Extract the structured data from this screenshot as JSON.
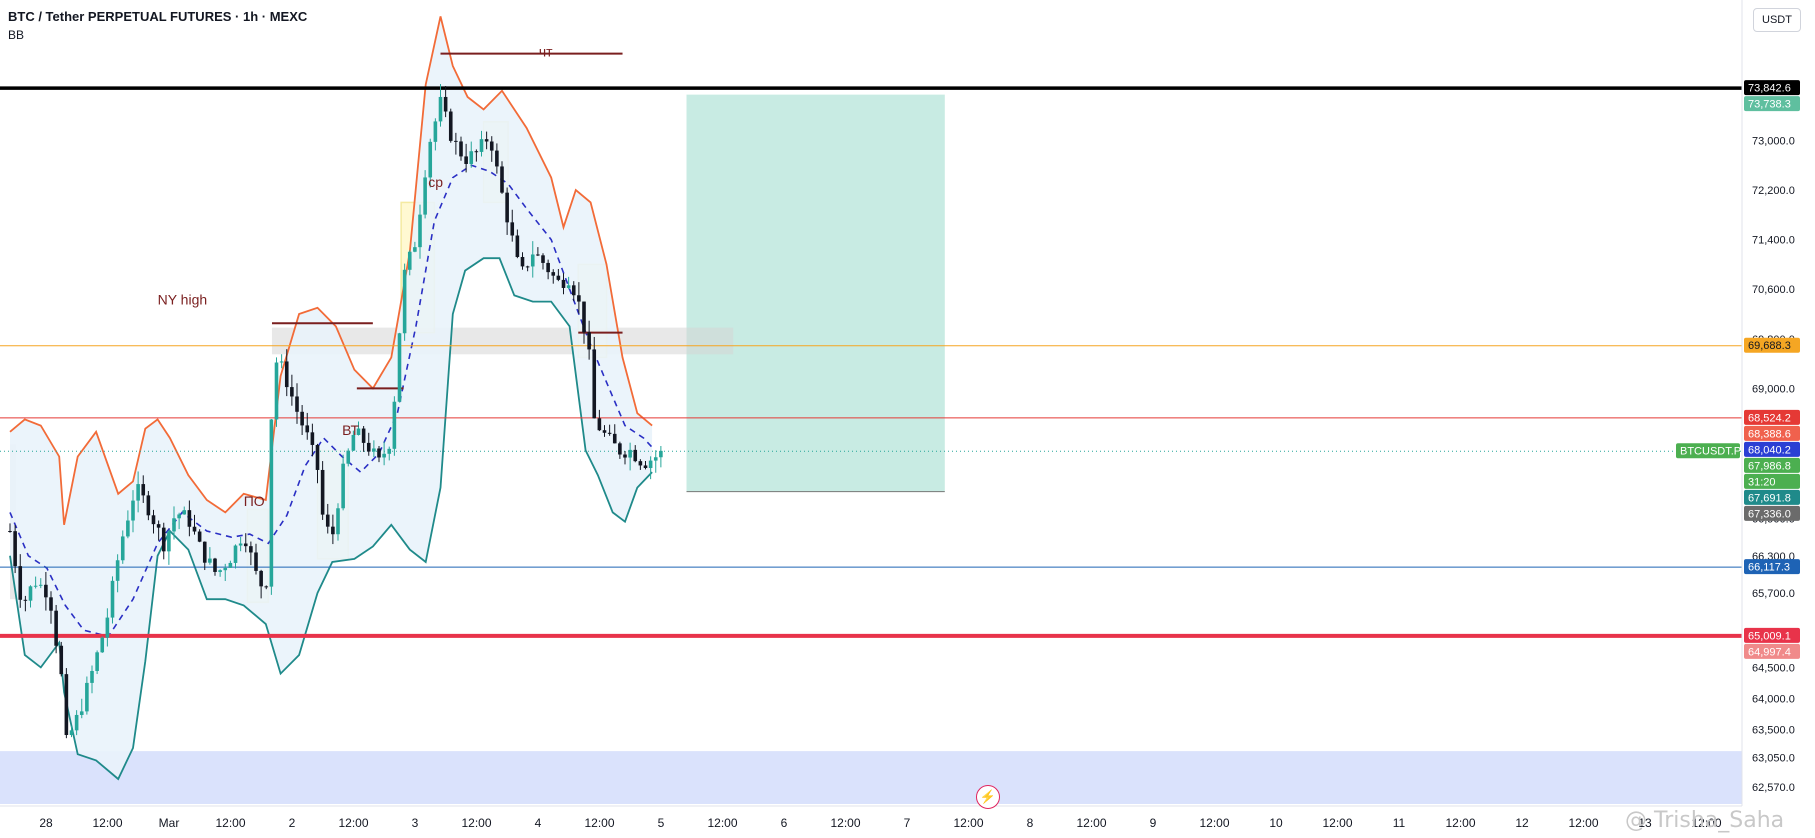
{
  "header": {
    "title": "BTC / Tether PERPETUAL FUTURES · 1h · MEXC",
    "indicator": "BB"
  },
  "currency_button": "USDT",
  "watermark": "@ Trisha_Saha",
  "icons": {
    "bolt": "lightning-bolt-icon"
  },
  "colors": {
    "up": "#26a69a",
    "down": "#131722",
    "bb_upper": "#f26b38",
    "bb_lower": "#1f8a8a",
    "bb_basis": "#2a2fc4",
    "bb_fill": "#e9f3fb",
    "line_black": "#000000",
    "line_orange": "#f5a623",
    "line_red_thin": "#e53935",
    "line_blue": "#1e63b5",
    "line_red_thick": "#e8334a",
    "target_zone": "#c8ebe3",
    "stop_zone": "#fde6e6",
    "demand_zone": "#d3ddfb",
    "supply_box": "#d6d6d6",
    "annotation": "#7a1f1f"
  },
  "chart_data": {
    "type": "candlestick",
    "symbol_label": "BTCUSDT.P",
    "ylim": [
      62200,
      75200
    ],
    "y_ticks": [
      62570,
      63050,
      63500,
      64000,
      64500,
      65000,
      65700,
      66300,
      66900,
      67300,
      69000,
      69800,
      70600,
      71400,
      72200,
      73000
    ],
    "y_tick_labels": [
      "62,570.0",
      "63,050.0",
      "63,500.0",
      "64,000.0",
      "64,500.0",
      "65,100.0",
      "65,700.0",
      "66,300.0",
      "66,900.0",
      "67,300.0",
      "69,000.0",
      "69,800.0",
      "70,600.0",
      "71,400.0",
      "72,200.0",
      "73,000.0"
    ],
    "x_labels": [
      "28",
      "12:00",
      "Mar",
      "12:00",
      "2",
      "12:00",
      "3",
      "12:00",
      "4",
      "12:00",
      "5",
      "12:00",
      "6",
      "12:00",
      "7",
      "12:00",
      "8",
      "12:00",
      "9",
      "12:00",
      "10",
      "12:00",
      "11",
      "12:00",
      "12",
      "12:00",
      "13",
      "12:00"
    ],
    "price_labels": [
      {
        "text": "73,842.6",
        "value": 73842.6,
        "bg": "#000000",
        "color": "#ffffff"
      },
      {
        "text": "73,738.3",
        "value": 73738.3,
        "bg": "#5fbf9f",
        "color": "#ffffff"
      },
      {
        "text": "69,688.3",
        "value": 69688.3,
        "bg": "#f5a623",
        "color": "#131722"
      },
      {
        "text": "68,524.2",
        "value": 68524.2,
        "bg": "#e53935",
        "color": "#ffffff"
      },
      {
        "text": "68,388.6",
        "value": 68388.6,
        "bg": "#f0614d",
        "color": "#ffffff"
      },
      {
        "text": "68,040.2",
        "value": 68040.2,
        "bg": "#2a3fd4",
        "color": "#ffffff"
      },
      {
        "text": "67,986.8",
        "value": 67986.8,
        "bg": "#4caf50",
        "color": "#ffffff"
      },
      {
        "text": "31:20",
        "value": 67820,
        "bg": "#4caf50",
        "color": "#ffffff"
      },
      {
        "text": "67,691.8",
        "value": 67691.8,
        "bg": "#1f8a8a",
        "color": "#ffffff"
      },
      {
        "text": "67,336.0",
        "value": 67336.0,
        "bg": "#6b6b6b",
        "color": "#ffffff"
      },
      {
        "text": "66,117.3",
        "value": 66117.3,
        "bg": "#1e63b5",
        "color": "#ffffff"
      },
      {
        "text": "65,009.1",
        "value": 65009.1,
        "bg": "#e8334a",
        "color": "#ffffff"
      },
      {
        "text": "64,997.4",
        "value": 64997.4,
        "bg": "#f08a8a",
        "color": "#ffffff"
      }
    ],
    "horizontal_lines": [
      {
        "value": 73842.6,
        "color": "#000000",
        "width": 3.5
      },
      {
        "value": 69688.3,
        "color": "#f5a623",
        "width": 1
      },
      {
        "value": 68524.2,
        "color": "#e53935",
        "width": 1
      },
      {
        "value": 66117.3,
        "color": "#1e63b5",
        "width": 1
      },
      {
        "value": 65009.1,
        "color": "#e8334a",
        "width": 4
      }
    ],
    "current_price": 67986.8,
    "annotations": [
      {
        "text": "NY high",
        "x": 1.2,
        "y": 70350
      },
      {
        "text": "ВТ",
        "x": 2.7,
        "y": 68250
      },
      {
        "text": "ПО",
        "x": 1.9,
        "y": 67100
      },
      {
        "text": "ср",
        "x": 3.4,
        "y": 72250
      },
      {
        "text": "чт",
        "x": 4.3,
        "y": 74350
      }
    ],
    "position": {
      "entry": 67336.0,
      "target": 73738.3,
      "stop": 65009.1
    },
    "candle_path": [
      [
        0.0,
        66700
      ],
      [
        0.1,
        65500
      ],
      [
        0.2,
        65900
      ],
      [
        0.32,
        65700
      ],
      [
        0.42,
        64300
      ],
      [
        0.44,
        63200
      ],
      [
        0.55,
        63700
      ],
      [
        0.65,
        64300
      ],
      [
        0.78,
        65200
      ],
      [
        0.9,
        66500
      ],
      [
        1.02,
        67400
      ],
      [
        1.12,
        67100
      ],
      [
        1.25,
        66500
      ],
      [
        1.35,
        67000
      ],
      [
        1.45,
        66900
      ],
      [
        1.55,
        66400
      ],
      [
        1.68,
        66000
      ],
      [
        1.8,
        66300
      ],
      [
        1.9,
        66700
      ],
      [
        2.0,
        66000
      ],
      [
        2.08,
        65700
      ],
      [
        2.14,
        69500
      ],
      [
        2.22,
        69300
      ],
      [
        2.32,
        68700
      ],
      [
        2.42,
        68200
      ],
      [
        2.5,
        67700
      ],
      [
        2.55,
        66800
      ],
      [
        2.62,
        66600
      ],
      [
        2.7,
        67600
      ],
      [
        2.8,
        68300
      ],
      [
        2.9,
        68100
      ],
      [
        3.0,
        67800
      ],
      [
        3.1,
        68200
      ],
      [
        3.2,
        70800
      ],
      [
        3.3,
        71400
      ],
      [
        3.4,
        72900
      ],
      [
        3.5,
        73600
      ],
      [
        3.6,
        73000
      ],
      [
        3.7,
        72700
      ],
      [
        3.8,
        72800
      ],
      [
        3.9,
        73100
      ],
      [
        3.98,
        72300
      ],
      [
        4.05,
        71700
      ],
      [
        4.15,
        70800
      ],
      [
        4.25,
        71200
      ],
      [
        4.35,
        71000
      ],
      [
        4.45,
        70700
      ],
      [
        4.55,
        70800
      ],
      [
        4.62,
        70400
      ],
      [
        4.7,
        69700
      ],
      [
        4.75,
        68500
      ],
      [
        4.85,
        68200
      ],
      [
        4.95,
        68000
      ],
      [
        5.05,
        68000
      ],
      [
        5.15,
        67800
      ],
      [
        5.25,
        67900
      ],
      [
        5.32,
        67980
      ]
    ],
    "bb_upper": [
      [
        0.0,
        68300
      ],
      [
        0.12,
        68500
      ],
      [
        0.25,
        68400
      ],
      [
        0.4,
        67900
      ],
      [
        0.44,
        66800
      ],
      [
        0.55,
        67900
      ],
      [
        0.7,
        68300
      ],
      [
        0.88,
        67300
      ],
      [
        1.0,
        67500
      ],
      [
        1.1,
        68350
      ],
      [
        1.2,
        68500
      ],
      [
        1.3,
        68200
      ],
      [
        1.45,
        67600
      ],
      [
        1.6,
        67200
      ],
      [
        1.75,
        67000
      ],
      [
        1.9,
        67300
      ],
      [
        2.08,
        67200
      ],
      [
        2.2,
        69200
      ],
      [
        2.35,
        70200
      ],
      [
        2.5,
        70300
      ],
      [
        2.65,
        70000
      ],
      [
        2.8,
        69300
      ],
      [
        2.95,
        69000
      ],
      [
        3.1,
        69500
      ],
      [
        3.25,
        71200
      ],
      [
        3.38,
        73900
      ],
      [
        3.5,
        75000
      ],
      [
        3.6,
        74200
      ],
      [
        3.72,
        73700
      ],
      [
        3.85,
        73500
      ],
      [
        4.0,
        73800
      ],
      [
        4.2,
        73200
      ],
      [
        4.4,
        72400
      ],
      [
        4.5,
        71600
      ],
      [
        4.6,
        72200
      ],
      [
        4.72,
        72000
      ],
      [
        4.85,
        71000
      ],
      [
        4.98,
        69500
      ],
      [
        5.1,
        68600
      ],
      [
        5.22,
        68400
      ]
    ],
    "bb_lower": [
      [
        0.0,
        66300
      ],
      [
        0.12,
        64700
      ],
      [
        0.25,
        64500
      ],
      [
        0.4,
        64900
      ],
      [
        0.44,
        64100
      ],
      [
        0.55,
        63100
      ],
      [
        0.7,
        63000
      ],
      [
        0.88,
        62700
      ],
      [
        1.0,
        63200
      ],
      [
        1.1,
        64600
      ],
      [
        1.2,
        66300
      ],
      [
        1.3,
        66700
      ],
      [
        1.45,
        66400
      ],
      [
        1.6,
        65600
      ],
      [
        1.75,
        65600
      ],
      [
        1.9,
        65500
      ],
      [
        2.08,
        65200
      ],
      [
        2.2,
        64400
      ],
      [
        2.35,
        64700
      ],
      [
        2.5,
        65700
      ],
      [
        2.62,
        66200
      ],
      [
        2.8,
        66250
      ],
      [
        2.95,
        66450
      ],
      [
        3.1,
        66800
      ],
      [
        3.25,
        66400
      ],
      [
        3.38,
        66200
      ],
      [
        3.5,
        67400
      ],
      [
        3.6,
        70200
      ],
      [
        3.7,
        70900
      ],
      [
        3.85,
        71100
      ],
      [
        3.98,
        71100
      ],
      [
        4.1,
        70500
      ],
      [
        4.25,
        70400
      ],
      [
        4.4,
        70400
      ],
      [
        4.55,
        70000
      ],
      [
        4.68,
        68000
      ],
      [
        4.78,
        67600
      ],
      [
        4.9,
        67000
      ],
      [
        5.0,
        66850
      ],
      [
        5.1,
        67400
      ],
      [
        5.22,
        67650
      ]
    ],
    "bb_basis": [
      [
        0.0,
        67000
      ],
      [
        0.15,
        66300
      ],
      [
        0.3,
        66100
      ],
      [
        0.45,
        65500
      ],
      [
        0.6,
        65100
      ],
      [
        0.8,
        65000
      ],
      [
        1.0,
        65600
      ],
      [
        1.2,
        66500
      ],
      [
        1.4,
        67000
      ],
      [
        1.6,
        66700
      ],
      [
        1.8,
        66600
      ],
      [
        1.95,
        66650
      ],
      [
        2.1,
        66500
      ],
      [
        2.25,
        66950
      ],
      [
        2.4,
        67750
      ],
      [
        2.55,
        68200
      ],
      [
        2.7,
        67900
      ],
      [
        2.85,
        67650
      ],
      [
        3.0,
        67950
      ],
      [
        3.15,
        68600
      ],
      [
        3.3,
        70000
      ],
      [
        3.45,
        71700
      ],
      [
        3.6,
        72400
      ],
      [
        3.75,
        72600
      ],
      [
        3.9,
        72500
      ],
      [
        4.05,
        72300
      ],
      [
        4.2,
        71900
      ],
      [
        4.4,
        71400
      ],
      [
        4.55,
        70600
      ],
      [
        4.7,
        69800
      ],
      [
        4.85,
        69100
      ],
      [
        5.0,
        68400
      ],
      [
        5.15,
        68200
      ],
      [
        5.22,
        68050
      ]
    ],
    "levels_boxes": [
      {
        "x0": 2.13,
        "x1": 5.88,
        "y0": 69550,
        "y1": 69980
      },
      {
        "x0": 0.0,
        "x1": 0.05,
        "y0": 65600,
        "y1": 68100
      }
    ],
    "hilite_boxes": [
      {
        "x0": 1.93,
        "x1": 2.1,
        "y0": 65550,
        "y1": 67050
      },
      {
        "x0": 2.5,
        "x1": 2.75,
        "y0": 66250,
        "y1": 68000
      },
      {
        "x0": 3.18,
        "x1": 3.45,
        "y0": 69900,
        "y1": 72000
      },
      {
        "x0": 3.85,
        "x1": 4.05,
        "y0": 72000,
        "y1": 73300
      },
      {
        "x0": 4.62,
        "x1": 4.85,
        "y0": 69500,
        "y1": 71000
      }
    ],
    "level_segments": [
      {
        "x0": 2.13,
        "x1": 2.95,
        "value": 70050,
        "color": "#7a1f1f"
      },
      {
        "x0": 2.82,
        "x1": 3.2,
        "value": 69000,
        "color": "#7a1f1f"
      },
      {
        "x0": 3.5,
        "x1": 4.98,
        "value": 74400,
        "color": "#7a1f1f"
      },
      {
        "x0": 4.62,
        "x1": 4.98,
        "value": 69900,
        "color": "#7a1f1f"
      }
    ],
    "target_zone": {
      "x0": 5.5,
      "x1": 7.6,
      "y0": 67336.0,
      "y1": 73738.3
    },
    "stop_zone": {
      "x0": 5.5,
      "x1": 7.6,
      "y0": 65009.1,
      "y1": 67336.0
    },
    "demand_zone": {
      "x0": 0.0,
      "x1": 9.7,
      "y0": 62200,
      "y1": 63150
    }
  }
}
